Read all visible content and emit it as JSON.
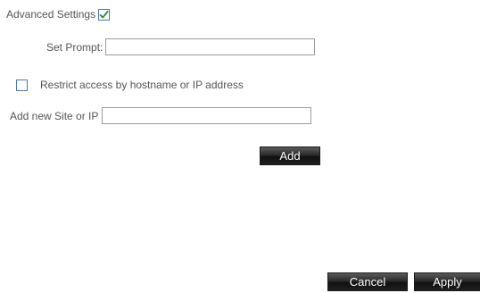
{
  "advanced": {
    "label": "Advanced Settings",
    "checked": true
  },
  "prompt": {
    "label": "Set Prompt:",
    "value": ""
  },
  "restrict": {
    "label": "Restrict access by hostname or IP address",
    "checked": false
  },
  "site": {
    "label": "Add new Site or IP",
    "value": ""
  },
  "buttons": {
    "add": "Add",
    "cancel": "Cancel",
    "apply": "Apply"
  },
  "colors": {
    "checkbox_border": "#4a7aa7",
    "checkmark": "#2f8a2f",
    "button_bg": "#1f1f1f",
    "button_text": "#ffffff"
  }
}
